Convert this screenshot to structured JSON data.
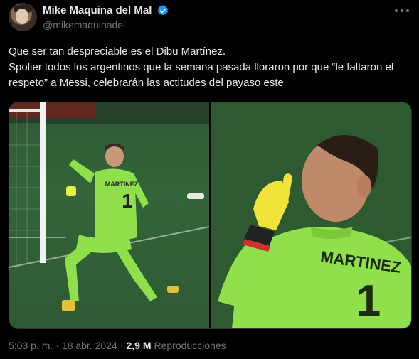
{
  "author": {
    "display_name": "Mike Maquina del Mal",
    "handle": "@mikemaquinadel",
    "verified": true
  },
  "tweet": {
    "line1": "Que ser tan despreciable es el Dibu Martínez.",
    "line2": "Spolier todos los argentinos que la semana pasada lloraron por que “le faltaron el respeto” a Messi, celebrarán las actitudes del payaso este"
  },
  "media": {
    "left": {
      "jersey_number": "1",
      "jersey_name": "MARTINEZ"
    },
    "right": {
      "jersey_number": "1",
      "jersey_name": "MARTINEZ"
    }
  },
  "meta": {
    "time": "5:03 p. m.",
    "separator": "·",
    "date": "18 abr. 2024",
    "separator2": "·",
    "views_count": "2,9 M",
    "views_label": "Reproducciones"
  },
  "colors": {
    "background": "#000000",
    "text": "#e7e9ea",
    "muted": "#71767b",
    "verified": "#1d9bf0",
    "jersey": "#8fe04a"
  },
  "icons": [
    "verified-badge-icon",
    "more-options-icon"
  ]
}
